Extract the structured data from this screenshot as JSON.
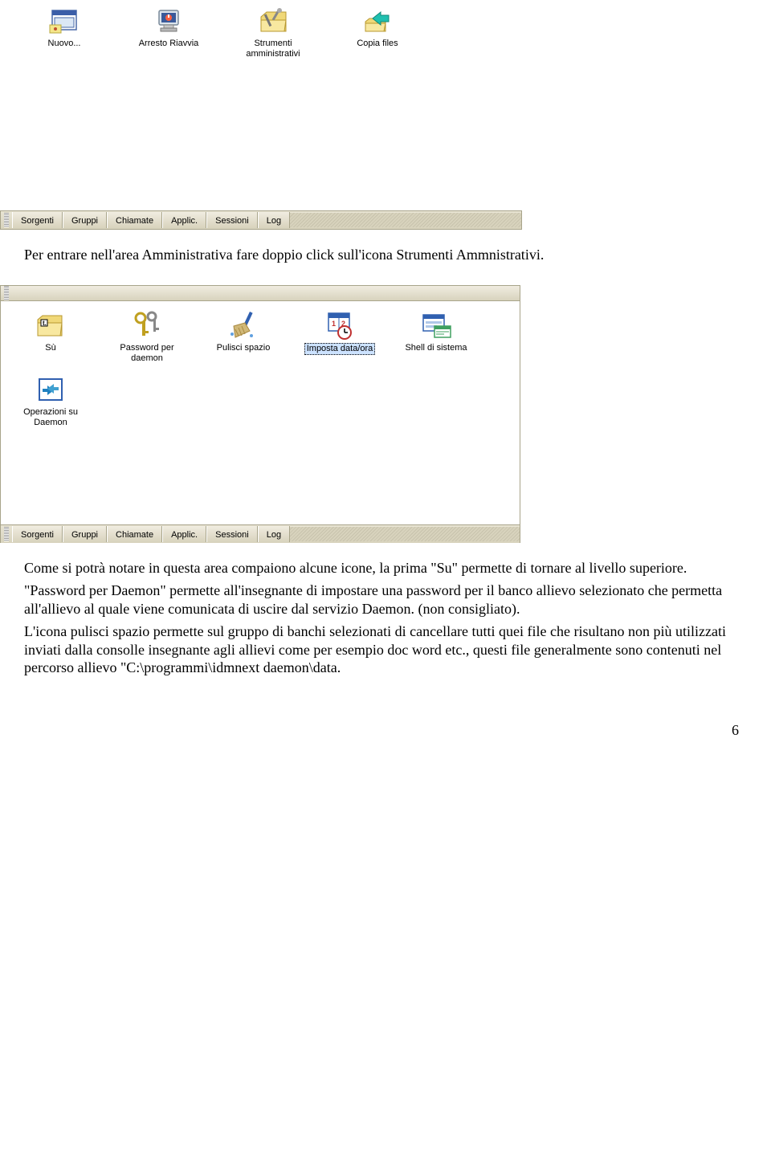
{
  "toolbar": {
    "items": [
      {
        "label": "Nuovo..."
      },
      {
        "label": "Arresto Riavvia"
      },
      {
        "label": "Strumenti amministrativi"
      },
      {
        "label": "Copia files"
      }
    ]
  },
  "tabs": {
    "items": [
      {
        "label": "Sorgenti"
      },
      {
        "label": "Gruppi"
      },
      {
        "label": "Chiamate"
      },
      {
        "label": "Applic."
      },
      {
        "label": "Sessioni"
      },
      {
        "label": "Log"
      }
    ]
  },
  "text": {
    "p1": "Per entrare nell'area Amministrativa fare doppio click sull'icona Strumenti Ammnistrativi.",
    "p2": "Come si potrà notare in questa area compaiono alcune icone, la prima \"Su\" permette di tornare al livello superiore.",
    "p3": "\"Password per Daemon\" permette all'insegnante di impostare una password per il banco allievo selezionato che permetta all'allievo al quale viene comunicata di uscire dal servizio Daemon. (non consigliato).",
    "p4": "L'icona pulisci spazio permette sul gruppo di banchi selezionati di cancellare tutti quei file che risultano non più utilizzati inviati dalla consolle insegnante agli allievi come per esempio doc word etc., questi file generalmente sono contenuti nel percorso allievo \"C:\\programmi\\idmnext daemon\\data."
  },
  "panel": {
    "items": [
      {
        "label": "Sù"
      },
      {
        "label": "Password per daemon"
      },
      {
        "label": "Pulisci spazio"
      },
      {
        "label": "Imposta data/ora",
        "selected": true
      },
      {
        "label": "Shell di sistema"
      },
      {
        "label": "Operazioni su Daemon"
      }
    ]
  },
  "page_number": "6"
}
